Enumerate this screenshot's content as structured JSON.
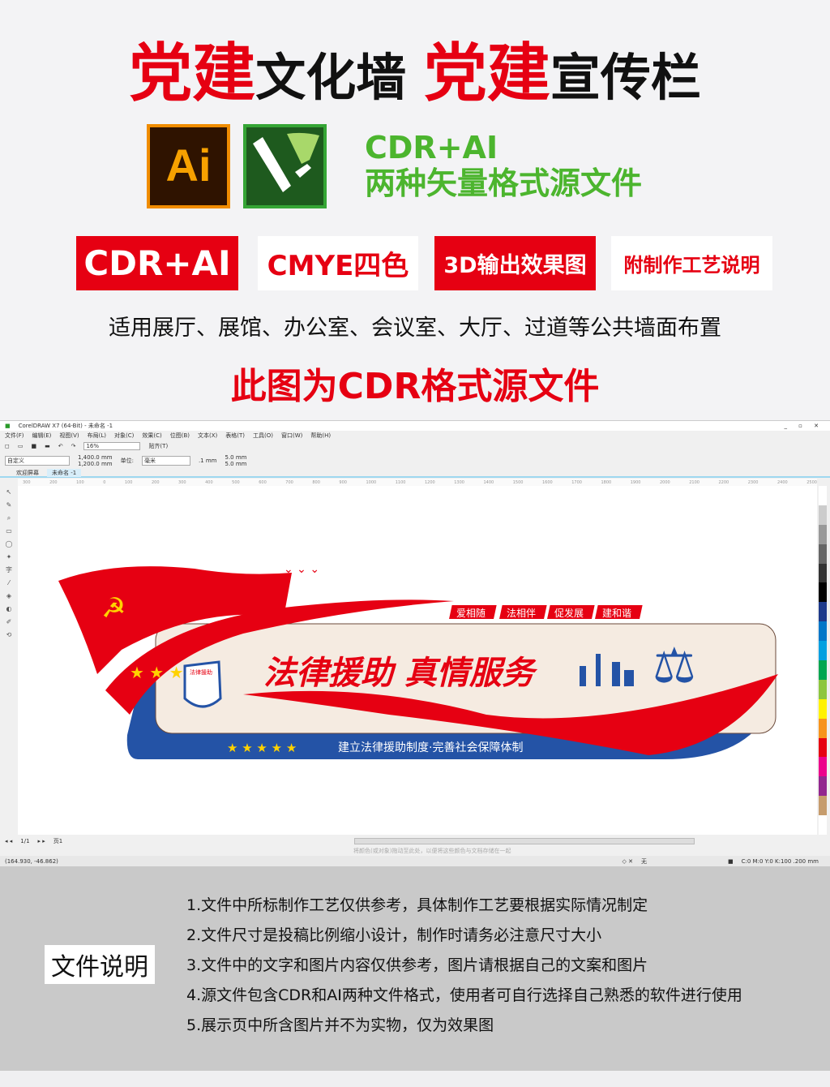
{
  "header": {
    "title_a_red": "党建",
    "title_a": "文化墙",
    "title_b_red": "党建",
    "title_b": "宣传栏"
  },
  "logos": {
    "ai_label": "Ai",
    "cdr_icon": "coreldraw-logo"
  },
  "formats": {
    "line1": "CDR+AI",
    "line2": "两种矢量格式源文件"
  },
  "badges": [
    "CDR+AI",
    "CMYE四色",
    "3D输出效果图",
    "附制作工艺说明"
  ],
  "usage": "适用展厅、展馆、办公室、会议室、大厅、过道等公共墙面布置",
  "source_note": "此图为CDR格式源文件",
  "corel": {
    "window_title": "CorelDRAW X7 (64-Bit) - 未命名 -1",
    "menu": [
      "文件(F)",
      "编辑(E)",
      "视图(V)",
      "布局(L)",
      "对象(C)",
      "效果(C)",
      "位图(B)",
      "文本(X)",
      "表格(T)",
      "工具(O)",
      "窗口(W)",
      "帮助(H)"
    ],
    "zoom": "16%",
    "snap": "贴齐(T)",
    "preset": "自定义",
    "width": "1,400.0 mm",
    "height": "1,200.0 mm",
    "unit_label": "单位:",
    "unit": "毫米",
    "nudge": ".1 mm",
    "dup_x": "5.0 mm",
    "dup_y": "5.0 mm",
    "tabs": [
      "欢迎屏幕",
      "未命名 -1"
    ],
    "ruler": [
      "300",
      "200",
      "100",
      "0",
      "100",
      "200",
      "300",
      "400",
      "500",
      "600",
      "700",
      "800",
      "900",
      "1000",
      "1100",
      "1200",
      "1300",
      "1400",
      "1500",
      "1600",
      "1700",
      "1800",
      "1900",
      "2000",
      "2100",
      "2200",
      "2300",
      "2400",
      "2500"
    ],
    "page_nav": "1/1",
    "page_tab": "页1",
    "coords": "(164.930, -46.862)",
    "fill_status": "无",
    "outline_status": "C:0 M:0 Y:0 K:100 .200 mm",
    "hint": "将颜色(或对象)拖动至此处，以便将这些颜色与文档存储在一起"
  },
  "design": {
    "tags": [
      "爱相随",
      "法相伴",
      "促发展",
      "建和谐"
    ],
    "main_title": "法律援助 真情服务",
    "subtitle": "建立法律援助制度·完善社会保障体制",
    "shield_text": "法律援助",
    "stars": "★ ★ ★ ★ ★",
    "colors": {
      "red": "#e60012",
      "blue": "#2453a6",
      "cream": "#f5ebe1"
    }
  },
  "file_notes": {
    "label": "文件说明",
    "items": [
      "1.文件中所标制作工艺仅供参考，具体制作工艺要根据实际情况制定",
      "2.文件尺寸是投稿比例缩小设计，制作时请务必注意尺寸大小",
      "3.文件中的文字和图片内容仅供参考，图片请根据自己的文案和图片",
      "4.源文件包含CDR和AI两种文件格式，使用者可自行选择自己熟悉的软件进行使用",
      "5.展示页中所含图片并不为实物，仅为效果图"
    ]
  }
}
